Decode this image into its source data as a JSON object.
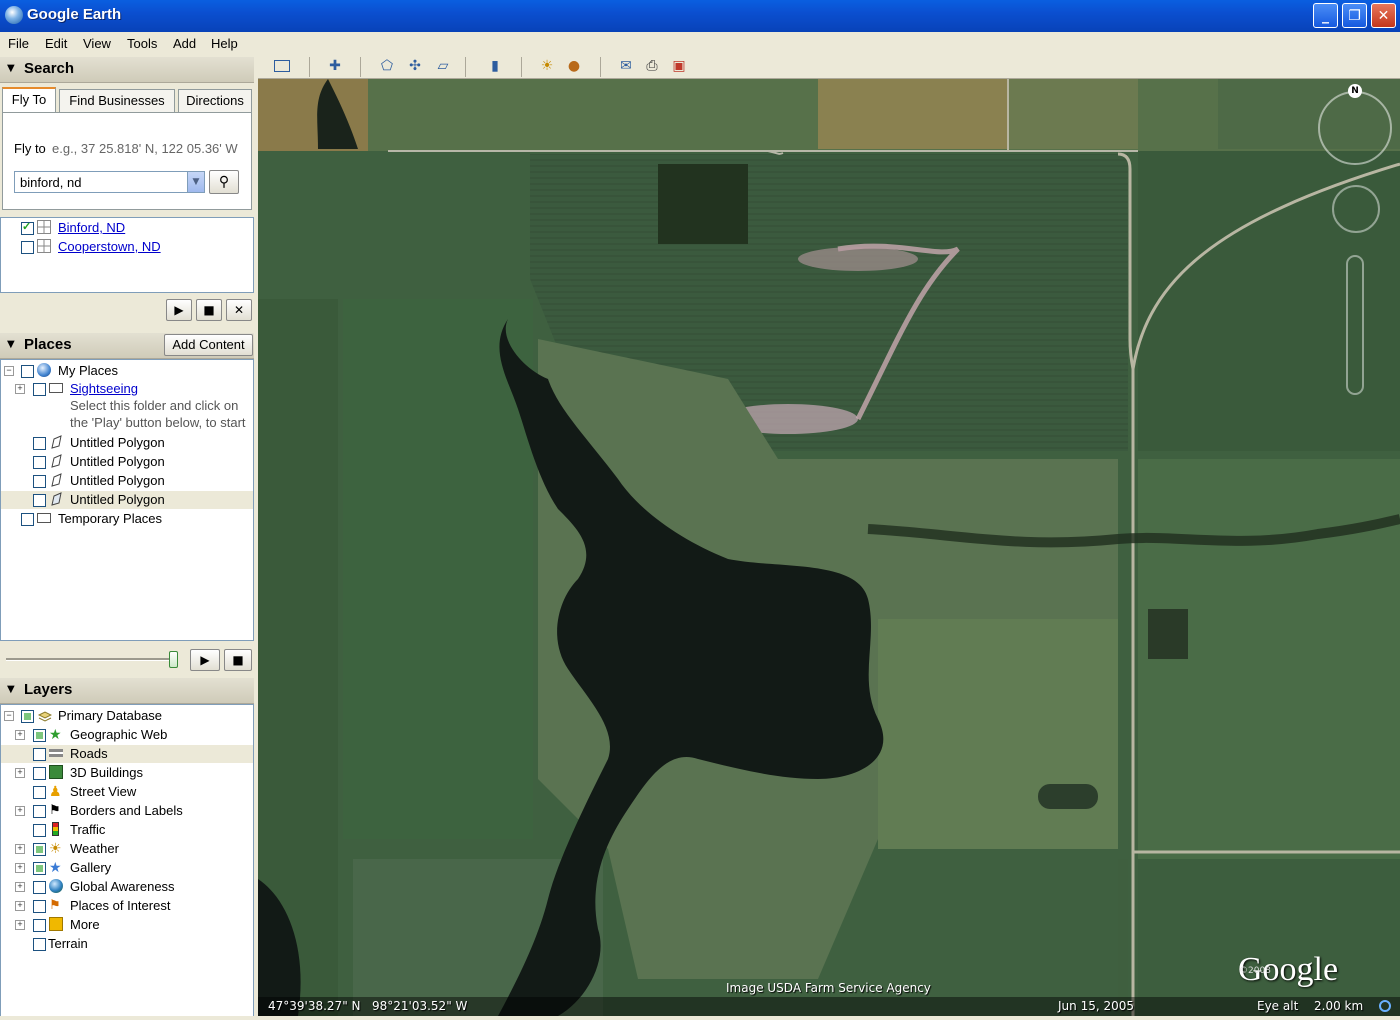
{
  "window": {
    "title": "Google Earth",
    "minimize": "_",
    "maximize": "❐",
    "close": "✕"
  },
  "menu": [
    "File",
    "Edit",
    "View",
    "Tools",
    "Add",
    "Help"
  ],
  "search": {
    "header": "Search",
    "tabs": [
      "Fly To",
      "Find Businesses",
      "Directions"
    ],
    "fly_to_label": "Fly to",
    "fly_to_hint": "e.g., 37 25.818' N, 122 05.36' W",
    "input_value": "binford, nd",
    "results": [
      {
        "label": "Binford, ND",
        "checked": true
      },
      {
        "label": "Cooperstown, ND",
        "checked": false
      }
    ]
  },
  "places": {
    "header": "Places",
    "add_content": "Add Content",
    "items": [
      {
        "label": "My Places"
      },
      {
        "label": "Sightseeing"
      },
      {
        "label": "Select this folder and click on"
      },
      {
        "label": "the 'Play' button below, to start"
      },
      {
        "label": "Untitled Polygon"
      },
      {
        "label": "Untitled Polygon"
      },
      {
        "label": "Untitled Polygon"
      },
      {
        "label": "Untitled Polygon"
      },
      {
        "label": "Temporary Places"
      }
    ]
  },
  "layers": {
    "header": "Layers",
    "items": [
      {
        "label": "Primary Database",
        "state": "partial"
      },
      {
        "label": "Geographic Web",
        "state": "partial"
      },
      {
        "label": "Roads",
        "state": "off"
      },
      {
        "label": "3D Buildings",
        "state": "off"
      },
      {
        "label": "Street View",
        "state": "off"
      },
      {
        "label": "Borders and Labels",
        "state": "off"
      },
      {
        "label": "Traffic",
        "state": "off"
      },
      {
        "label": "Weather",
        "state": "partial"
      },
      {
        "label": "Gallery",
        "state": "partial"
      },
      {
        "label": "Global Awareness",
        "state": "off"
      },
      {
        "label": "Places of Interest",
        "state": "off"
      },
      {
        "label": "More",
        "state": "off"
      },
      {
        "label": "Terrain",
        "state": "off"
      }
    ]
  },
  "map": {
    "compass_n": "N",
    "imagery_credit": "Image USDA Farm Service Agency",
    "copyright_year": "©2008",
    "logo": "Google",
    "lat": "47°39'38.27\" N",
    "lon": "98°21'03.52\" W",
    "date": "Jun 15, 2005",
    "eye_alt_label": "Eye alt",
    "eye_alt_value": "2.00 km"
  },
  "colors": {
    "titlebar": "#0b4fd0",
    "panel": "#ece9d8",
    "link": "#0000cc"
  }
}
